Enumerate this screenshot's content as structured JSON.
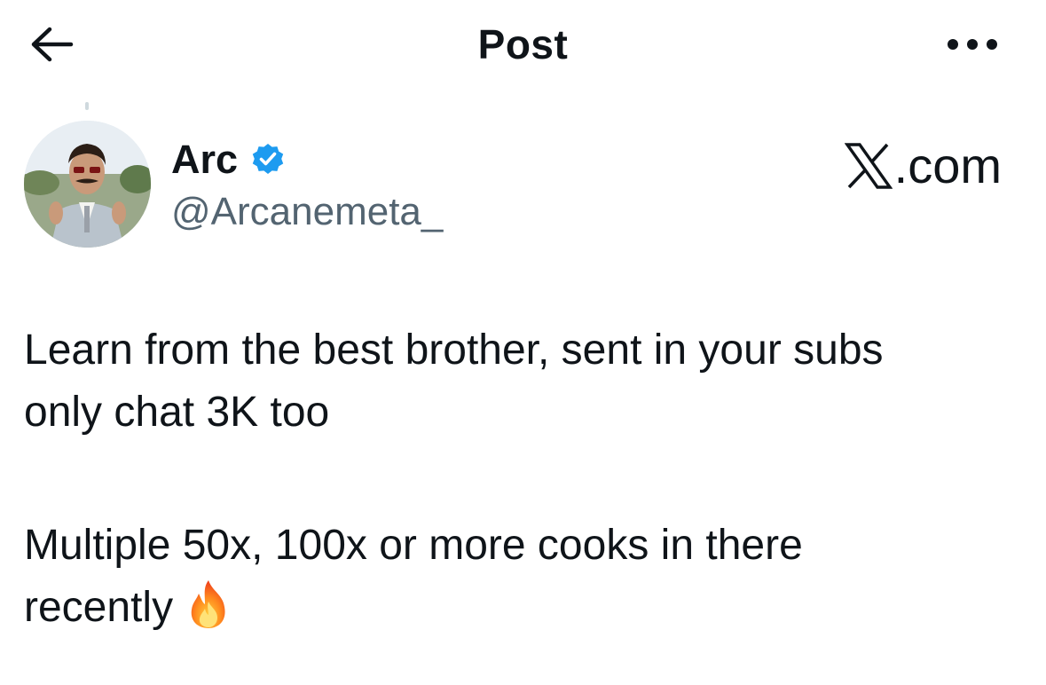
{
  "header": {
    "title": "Post",
    "back_icon": "arrow-left-icon",
    "more_icon": "more-horizontal-icon"
  },
  "author": {
    "name": "Arc",
    "handle": "@Arcanemeta_",
    "verified_icon": "verified-badge-icon",
    "verified_color": "#1d9bf0"
  },
  "watermark": {
    "text": ".com",
    "logo_icon": "x-logo-icon"
  },
  "post": {
    "lines": [
      "Learn from the best brother, sent in your subs",
      "only chat 3K too",
      "Multiple 50x, 100x or more cooks in there",
      "recently"
    ],
    "emoji_icon": "fire-emoji-icon"
  },
  "colors": {
    "text": "#0f1419",
    "secondary": "#536471",
    "accent": "#1d9bf0",
    "background": "#ffffff"
  }
}
